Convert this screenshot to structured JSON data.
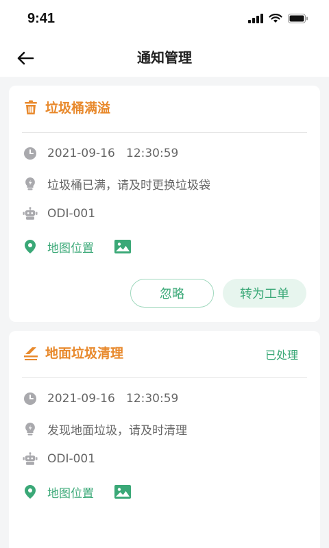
{
  "status_bar": {
    "time": "9:41"
  },
  "nav": {
    "title": "通知管理"
  },
  "colors": {
    "accent_green": "#3aa877",
    "title_orange": "#e8892c",
    "icon_gray": "#a9a9ad"
  },
  "cards": [
    {
      "title": "垃圾桶满溢",
      "status": "",
      "header_icon": "trash-bin-icon",
      "time": "2021-09-16   12:30:59",
      "message": "垃圾桶已满，请及时更换垃圾袋",
      "device": "ODI-001",
      "location_label": "地图位置",
      "buttons": {
        "ignore": "忽略",
        "convert": "转为工单"
      }
    },
    {
      "title": "地面垃圾清理",
      "status": "已处理",
      "header_icon": "ground-litter-icon",
      "time": "2021-09-16   12:30:59",
      "message": "发现地面垃圾，请及时清理",
      "device": "ODI-001",
      "location_label": "地图位置"
    }
  ]
}
